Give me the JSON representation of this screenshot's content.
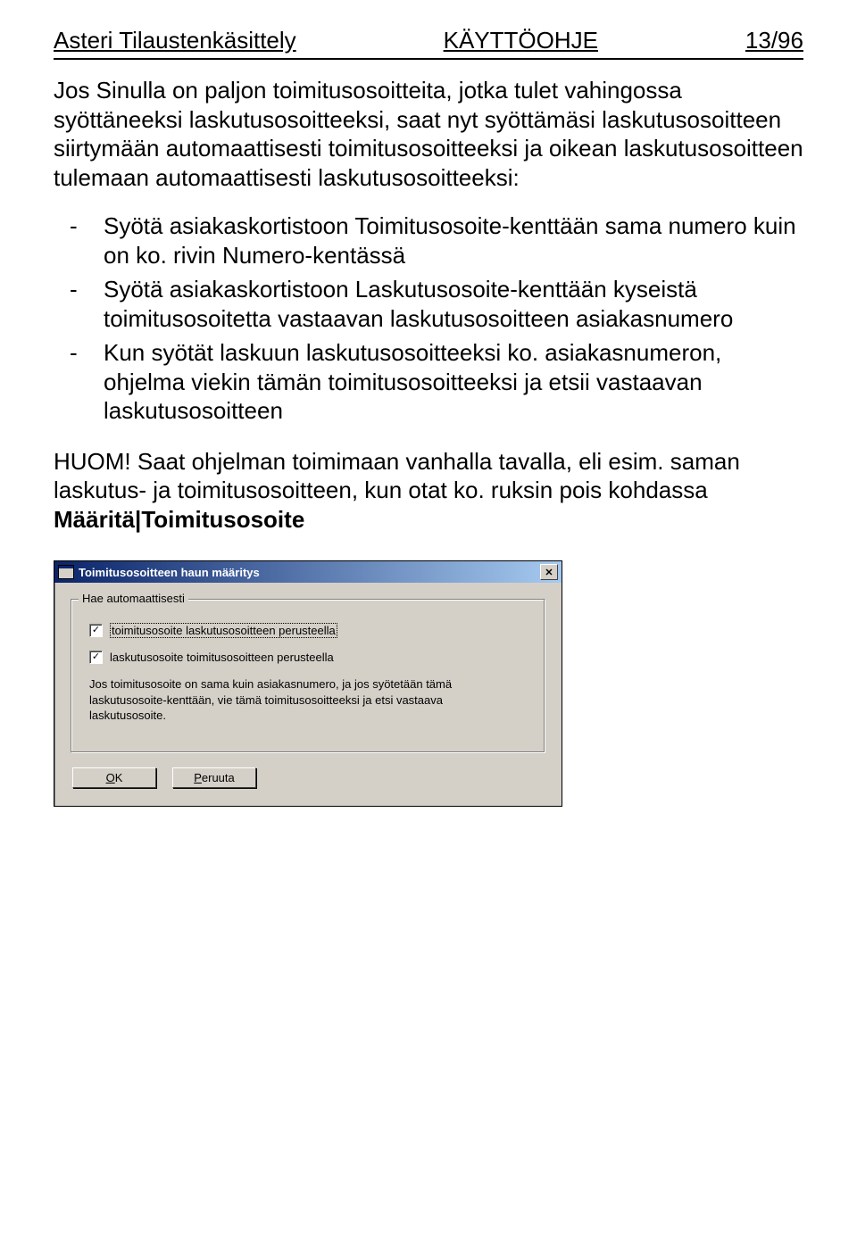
{
  "header": {
    "left": "Asteri Tilaustenkäsittely",
    "center": "KÄYTTÖOHJE",
    "right": "13/96"
  },
  "para1": "Jos Sinulla on paljon toimitusosoitteita, jotka tulet vahingossa syöttäneeksi laskutusosoitteeksi, saat nyt syöttämäsi laskutusosoitteen siirtymään automaattisesti toimitusosoitteeksi ja oikean laskutusosoitteen tulemaan automaattisesti laskutusosoitteeksi:",
  "bullets": [
    "Syötä asiakaskortistoon Toimitusosoite-kenttään sama numero kuin on ko. rivin Numero-kentässä",
    "Syötä asiakaskortistoon Laskutusosoite-kenttään kyseistä toimitusosoitetta vastaavan laskutusosoitteen asiakasnumero",
    "Kun syötät laskuun laskutusosoitteeksi ko. asiakasnumeron, ohjelma viekin tämän toimitusosoitteeksi ja etsii vastaavan laskutusosoitteen"
  ],
  "note_pre": "HUOM! Saat ohjelman toimimaan vanhalla tavalla, eli esim. saman laskutus- ja toimitusosoitteen, kun otat ko. ruksin pois kohdassa ",
  "note_bold": "Määritä|Toimitusosoite",
  "dialog": {
    "title": "Toimitusosoitteen haun määritys",
    "group_title": "Hae automaattisesti",
    "check1": "toimitusosoite laskutusosoitteen perusteella",
    "check2": "laskutusosoite toimitusosoitteen perusteella",
    "info": "Jos toimitusosoite on sama kuin asiakasnumero, ja jos syötetään tämä laskutusosoite-kenttään, vie tämä toimitusosoitteeksi ja etsi vastaava laskutusosoite.",
    "ok_rest": "K",
    "ok_mn": "O",
    "cancel_rest": "eruuta",
    "cancel_mn": "P"
  }
}
